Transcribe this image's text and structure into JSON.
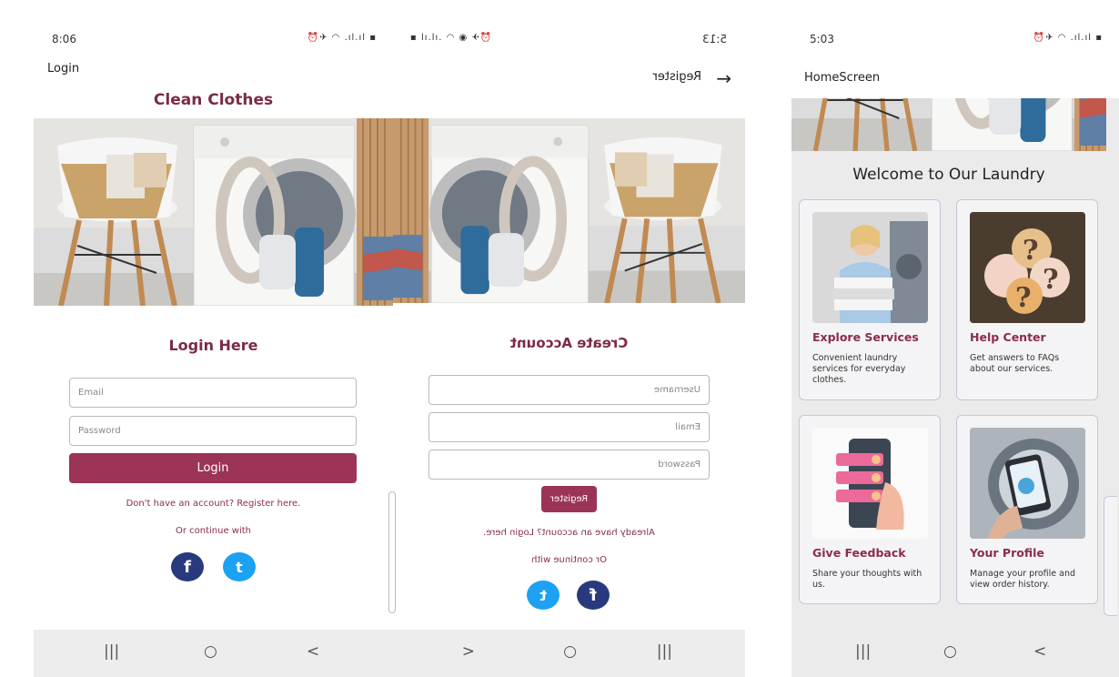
{
  "login_screen": {
    "status_time": "8:06",
    "app_bar_title": "Login",
    "banner_title": "Clean Clothes",
    "form_title": "Login Here",
    "email_placeholder": "Email",
    "password_placeholder": "Password",
    "login_button": "Login",
    "register_link": "Don't have an account? Register here.",
    "continue_with": "Or continue with",
    "facebook_glyph": "f",
    "twitter_glyph": "t"
  },
  "register_screen": {
    "status_time": "5:13",
    "app_bar_title": "Register",
    "form_title": "Create Account",
    "username_placeholder": "Username",
    "email_placeholder": "Email",
    "password_placeholder": "Password",
    "register_button": "Register",
    "login_link": "Already have an account? Login here.",
    "continue_with": "Or continue with",
    "facebook_glyph": "f",
    "twitter_glyph": "t"
  },
  "home_screen": {
    "status_time": "5:03",
    "app_bar_title": "HomeScreen",
    "welcome_title": "Welcome to Our Laundry",
    "cards": [
      {
        "title": "Explore Services",
        "description": "Convenient laundry services for everyday clothes.",
        "icon": "laundry-worker-image"
      },
      {
        "title": "Help Center",
        "description": "Get answers to FAQs about our services.",
        "icon": "question-marks-image"
      },
      {
        "title": "Give Feedback",
        "description": "Share your thoughts with us.",
        "icon": "phone-feedback-image"
      },
      {
        "title": "Your Profile",
        "description": "Manage your profile and view order history.",
        "icon": "phone-washer-image"
      }
    ]
  },
  "navigation": {
    "recents_glyph": "|||",
    "home_glyph": "○",
    "back_glyph": "<",
    "forward_glyph": ">"
  },
  "colors": {
    "accent": "#9b3456",
    "link": "#8b2c4c",
    "facebook": "#283a7d",
    "twitter": "#1da1f2"
  }
}
